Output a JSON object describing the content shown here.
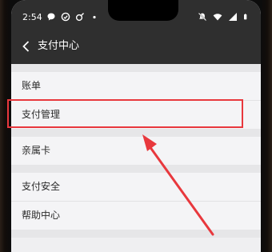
{
  "status_bar": {
    "time": "2:54",
    "left_icons": [
      "message-bubble-icon",
      "wechat-icon",
      "satellite-icon",
      "dot-icon"
    ],
    "right_icons": [
      "mute-icon",
      "wifi-icon",
      "signal-icon",
      "battery-icon"
    ]
  },
  "header": {
    "back_icon": "chevron-left-icon",
    "title": "支付中心"
  },
  "menu": {
    "items": [
      {
        "label": "账单"
      },
      {
        "label": "支付管理"
      },
      {
        "label": "亲属卡"
      },
      {
        "label": "支付安全"
      },
      {
        "label": "帮助中心"
      }
    ]
  },
  "annotation": {
    "highlight_color": "#e8383d",
    "highlighted_item": "支付管理"
  },
  "colors": {
    "header_bg": "#2f2f2f",
    "list_bg": "#f4f4f6",
    "separator_bg": "#e6e6e8"
  }
}
